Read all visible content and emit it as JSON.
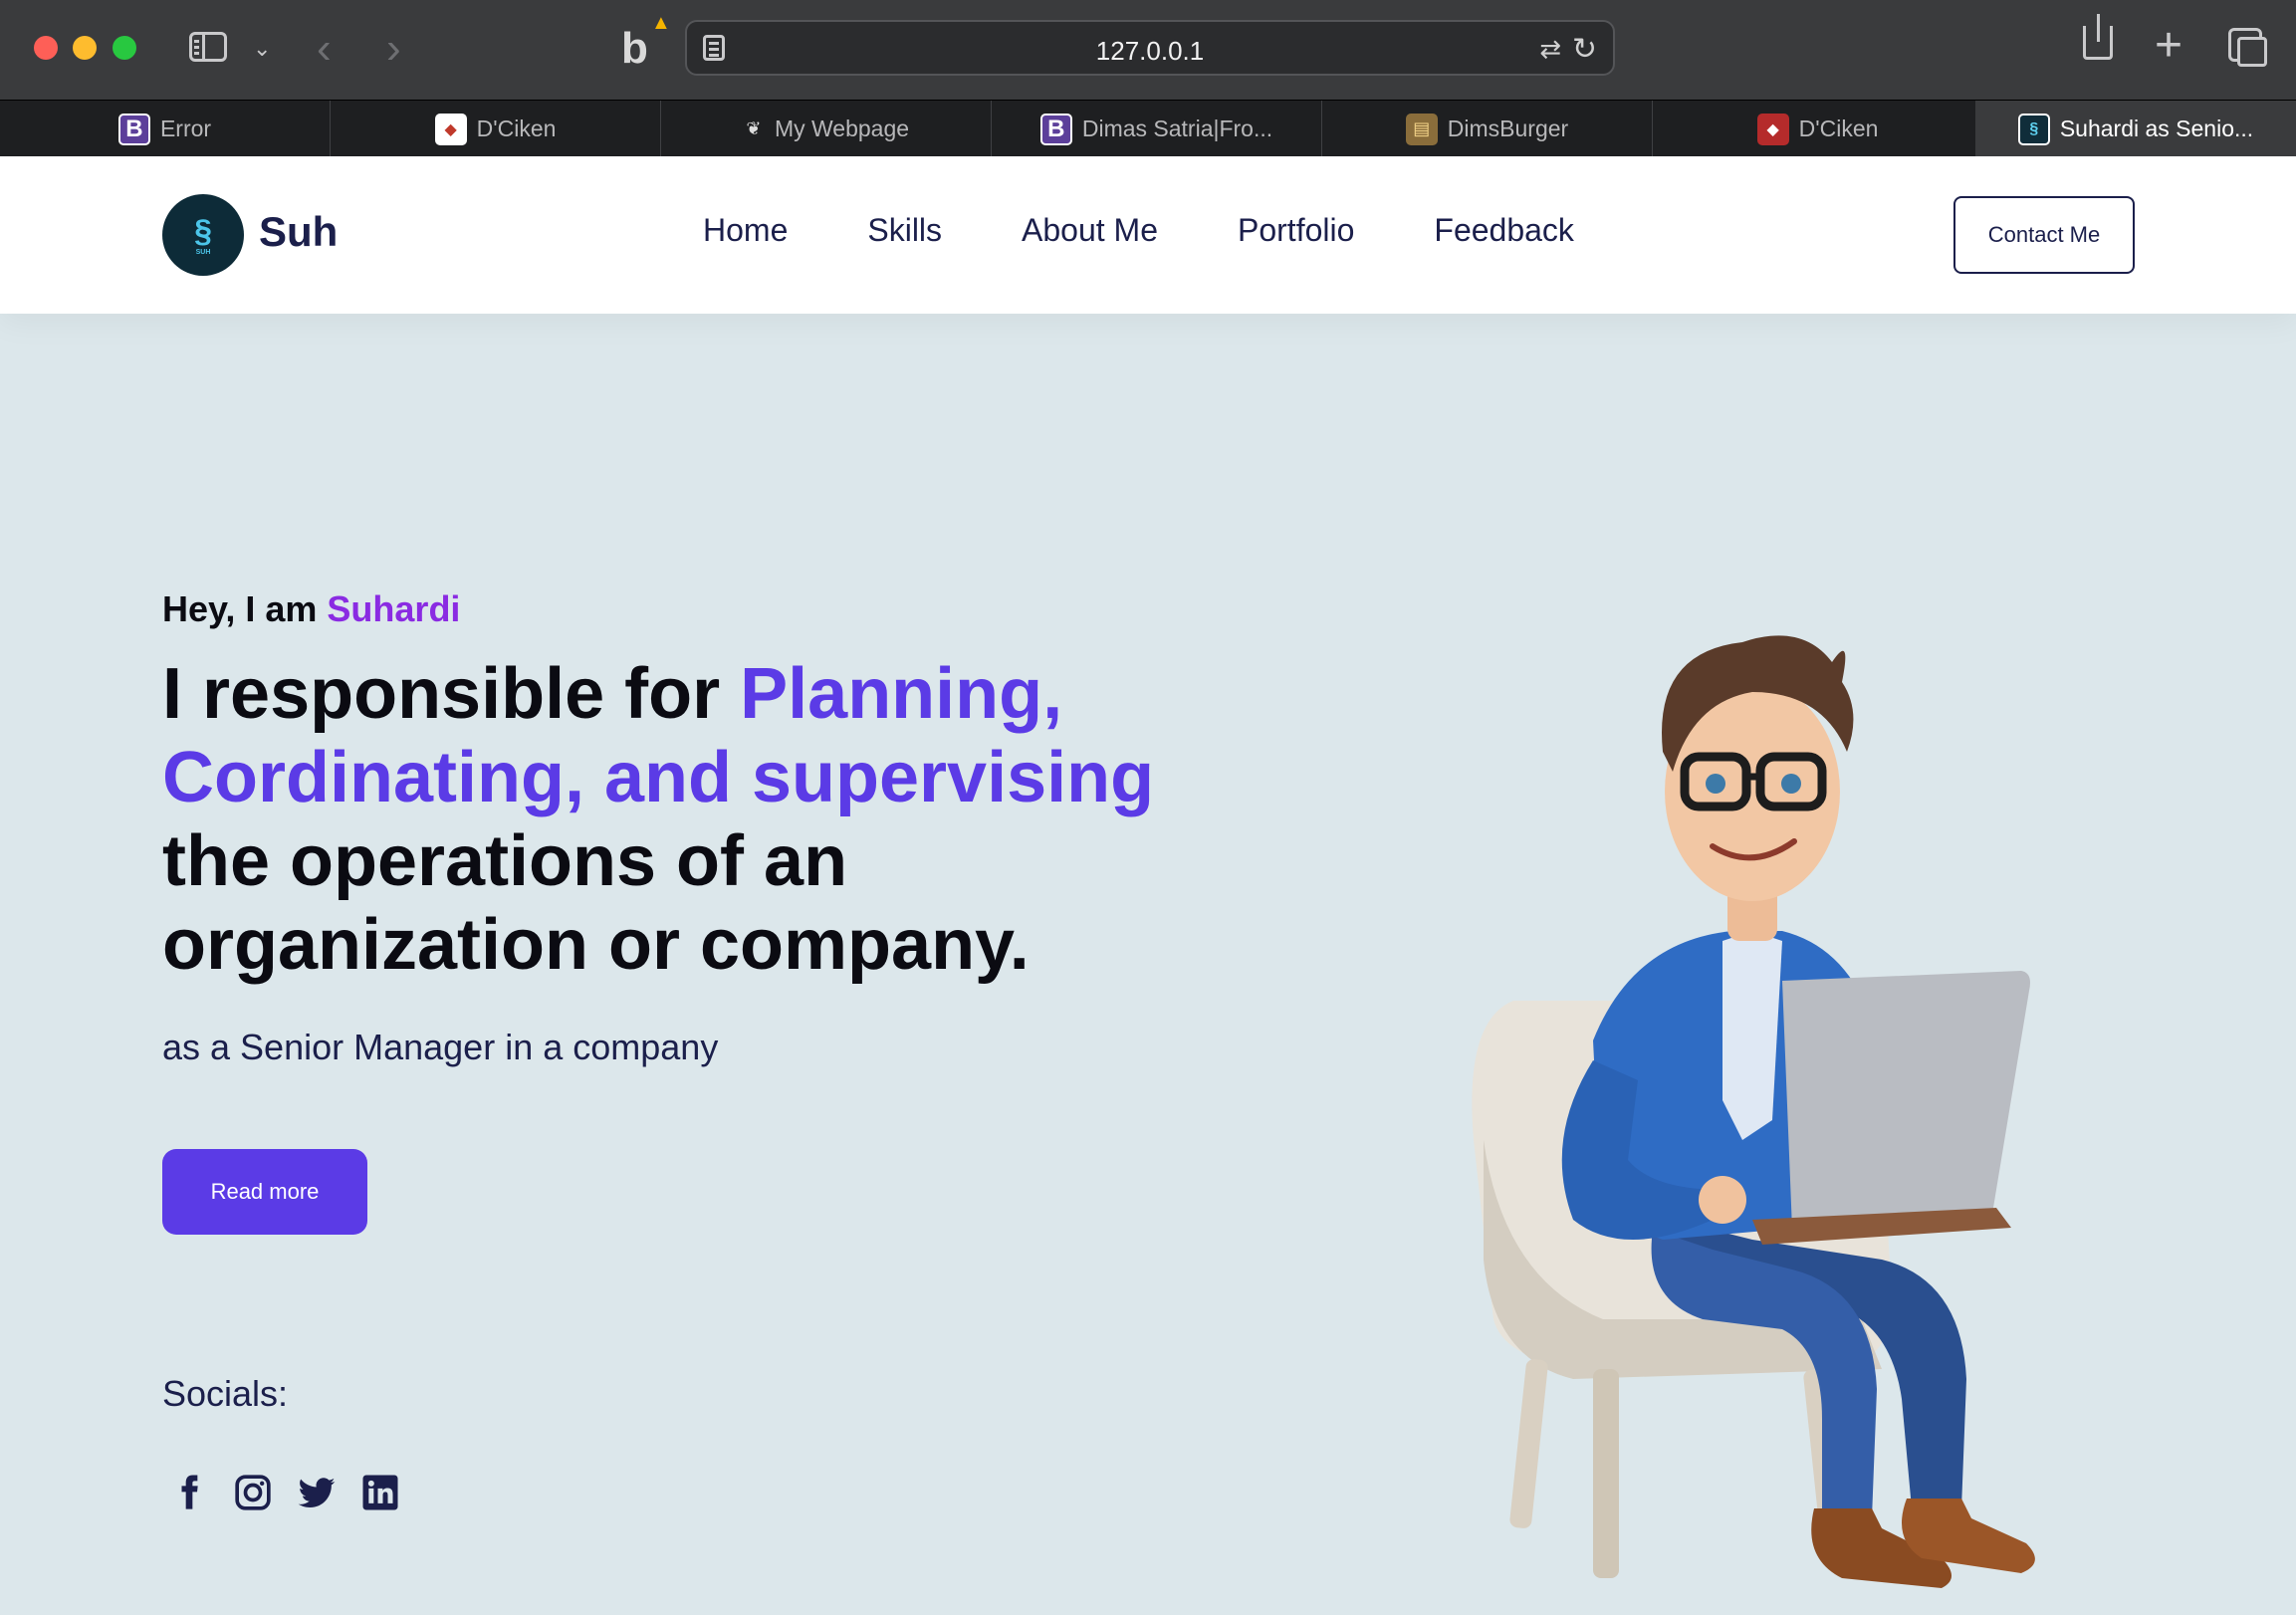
{
  "browser": {
    "url": "127.0.0.1",
    "tabs": [
      {
        "title": "Error",
        "favicon": "bootstrap-b-icon"
      },
      {
        "title": "D'Ciken",
        "favicon": "chicken-logo-icon"
      },
      {
        "title": "My Webpage",
        "favicon": "webpage-logo-icon"
      },
      {
        "title": "Dimas Satria|Fro...",
        "favicon": "bootstrap-b-icon"
      },
      {
        "title": "DimsBurger",
        "favicon": "burger-icon"
      },
      {
        "title": "D'Ciken",
        "favicon": "chicken-logo-icon"
      },
      {
        "title": "Suhardi as Senio...",
        "favicon": "suh-logo-icon",
        "active": true
      }
    ]
  },
  "site": {
    "brand": "Suh",
    "logo_text": "SUH",
    "nav": [
      "Home",
      "Skills",
      "About Me",
      "Portfolio",
      "Feedback"
    ],
    "contact_label": "Contact Me"
  },
  "hero": {
    "greeting_prefix": "Hey, I am ",
    "greeting_name": "Suhardi",
    "headline_part1": "I responsible for ",
    "headline_highlight": "Planning, Cordinating, and supervising",
    "headline_part2": " the operations of an organization or company.",
    "subtitle": "as a Senior Manager in a company",
    "button_label": "Read more",
    "socials_title": "Socials:",
    "socials": [
      "facebook-icon",
      "instagram-icon",
      "twitter-icon",
      "linkedin-icon"
    ]
  },
  "colors": {
    "accent": "#5b3be6",
    "name_accent": "#8a2be2",
    "navy": "#1b1f4b",
    "hero_bg": "#dce7eb"
  }
}
